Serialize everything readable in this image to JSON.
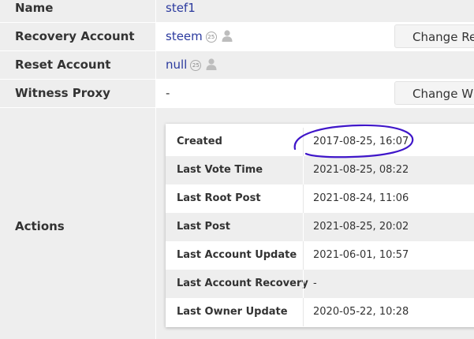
{
  "rows": {
    "name": {
      "label": "Name",
      "value": "stef1"
    },
    "recovery": {
      "label": "Recovery Account",
      "value": "steem",
      "rep": "25",
      "button": "Change Re"
    },
    "reset": {
      "label": "Reset Account",
      "value": "null",
      "rep": "25"
    },
    "proxy": {
      "label": "Witness Proxy",
      "value": "-",
      "button": "Change W"
    },
    "actions": {
      "label": "Actions"
    }
  },
  "actions_table": [
    {
      "key": "Created",
      "value": "2017-08-25, 16:07"
    },
    {
      "key": "Last Vote Time",
      "value": "2021-08-25, 08:22"
    },
    {
      "key": "Last Root Post",
      "value": "2021-08-24, 11:06"
    },
    {
      "key": "Last Post",
      "value": "2021-08-25, 20:02"
    },
    {
      "key": "Last Account Update",
      "value": "2021-06-01, 10:57"
    },
    {
      "key": "Last Account Recovery",
      "value": "-"
    },
    {
      "key": "Last Owner Update",
      "value": "2020-05-22, 10:28"
    }
  ],
  "colors": {
    "link": "#2b3a9e",
    "annotation": "#3f16c9",
    "row_shade": "#eeeeee"
  },
  "icons": {
    "reputation": "reputation-badge-icon",
    "user": "user-silhouette-icon"
  }
}
